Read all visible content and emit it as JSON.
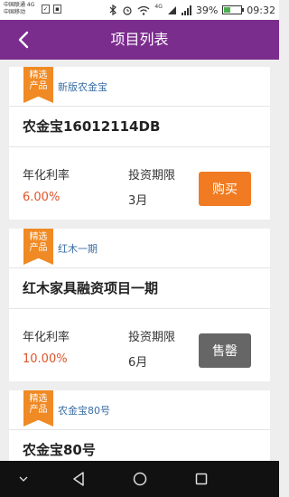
{
  "status_bar": {
    "carrier_line1": "中国联通 4G",
    "carrier_line2": "中国移动",
    "network_label": "4G",
    "battery_percent": "39%",
    "battery_level": 0.39,
    "time": "09:32"
  },
  "header": {
    "title": "项目列表"
  },
  "products": [
    {
      "badge_line1": "精选",
      "badge_line2": "产品",
      "series": "新版农金宝",
      "name": "农金宝16012114DB",
      "rate_label": "年化利率",
      "rate_value": "6.00%",
      "term_label": "投资期限",
      "term_value": "3月",
      "action_label": "购买",
      "action_color": "#f07b22"
    },
    {
      "badge_line1": "精选",
      "badge_line2": "产品",
      "series": "红木一期",
      "name": "红木家具融资项目一期",
      "rate_label": "年化利率",
      "rate_value": "10.00%",
      "term_label": "投资期限",
      "term_value": "6月",
      "action_label": "售罄",
      "action_color": "#666666"
    },
    {
      "badge_line1": "精选",
      "badge_line2": "产品",
      "series": "农金宝80号",
      "name": "农金宝80号"
    }
  ],
  "colors": {
    "header_bg": "#7b2d8e",
    "ribbon": "#f08a24",
    "rate_text": "#e0542a"
  }
}
